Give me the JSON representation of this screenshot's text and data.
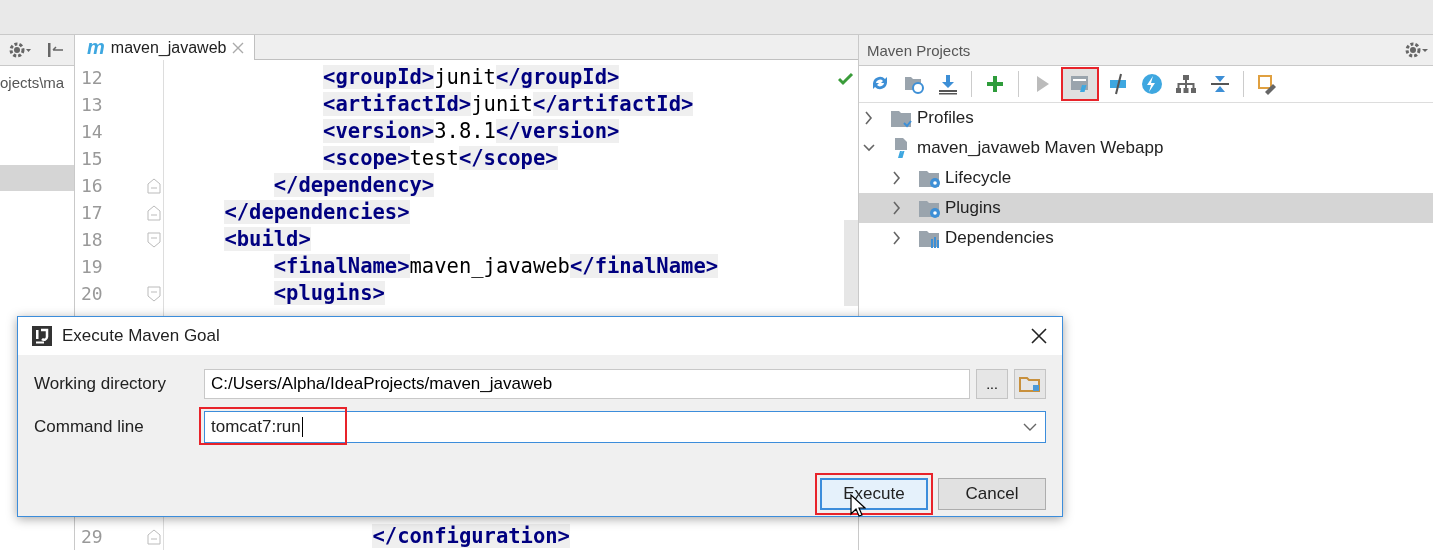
{
  "left_panel": {
    "path": "ojects\\ma"
  },
  "editor": {
    "tab": {
      "icon_text": "m",
      "title": "maven_javaweb",
      "selected": true
    },
    "lines": [
      {
        "number": "12",
        "code": "            <groupId>junit</groupId>",
        "kind": "plain"
      },
      {
        "number": "13",
        "code": "            <artifactId>junit</artifactId>",
        "kind": "plain"
      },
      {
        "number": "14",
        "code": "            <version>3.8.1</version>",
        "kind": "plain"
      },
      {
        "number": "15",
        "code": "            <scope>test</scope>",
        "kind": "plain"
      },
      {
        "number": "16",
        "code": "        </dependency>",
        "kind": "fold_end"
      },
      {
        "number": "17",
        "code": "    </dependencies>",
        "kind": "fold_end"
      },
      {
        "number": "18",
        "code": "    <build>",
        "kind": "fold_start"
      },
      {
        "number": "19",
        "code": "        <finalName>maven_javaweb</finalName>",
        "kind": "plain"
      },
      {
        "number": "20",
        "code": "        <plugins>",
        "kind": "fold_start"
      },
      {
        "number": "29",
        "code": "                </configuration>",
        "kind": "fold_end"
      }
    ]
  },
  "maven_panel": {
    "title": "Maven Projects",
    "toolbar": [
      {
        "kind": "refresh",
        "marked": false
      },
      {
        "kind": "reimport",
        "marked": false
      },
      {
        "kind": "download",
        "marked": false
      },
      {
        "kind": "separator",
        "marked": false
      },
      {
        "kind": "add",
        "marked": false
      },
      {
        "kind": "separator",
        "marked": false
      },
      {
        "kind": "run",
        "marked": false
      },
      {
        "kind": "goal",
        "marked": true
      },
      {
        "kind": "toggle",
        "marked": false
      },
      {
        "kind": "lightning",
        "marked": false
      },
      {
        "kind": "hierarchy",
        "marked": false
      },
      {
        "kind": "collapse",
        "marked": false
      },
      {
        "kind": "separator",
        "marked": false
      },
      {
        "kind": "settings",
        "marked": false
      }
    ],
    "tree": [
      {
        "label": "Profiles",
        "kind": "profiles",
        "expanded": false,
        "selected": false
      },
      {
        "label": "maven_javaweb Maven Webapp",
        "kind": "project",
        "expanded": true,
        "selected": false,
        "children": [
          {
            "label": "Lifecycle",
            "kind": "lifecycle",
            "expanded": false,
            "selected": false
          },
          {
            "label": "Plugins",
            "kind": "plugins",
            "expanded": false,
            "selected": true
          },
          {
            "label": "Dependencies",
            "kind": "dependencies",
            "expanded": false,
            "selected": false
          }
        ]
      }
    ]
  },
  "dialog": {
    "title": "Execute Maven Goal",
    "working_directory": {
      "label": "Working directory",
      "value": "C:/Users/Alpha/IdeaProjects/maven_javaweb",
      "browse_button": "..."
    },
    "command_line": {
      "label": "Command line",
      "value": "tomcat7:run",
      "marked": true
    },
    "buttons": [
      {
        "label": "Execute",
        "kind": "default",
        "marked": true
      },
      {
        "label": "Cancel",
        "kind": "normal",
        "marked": false
      }
    ]
  }
}
